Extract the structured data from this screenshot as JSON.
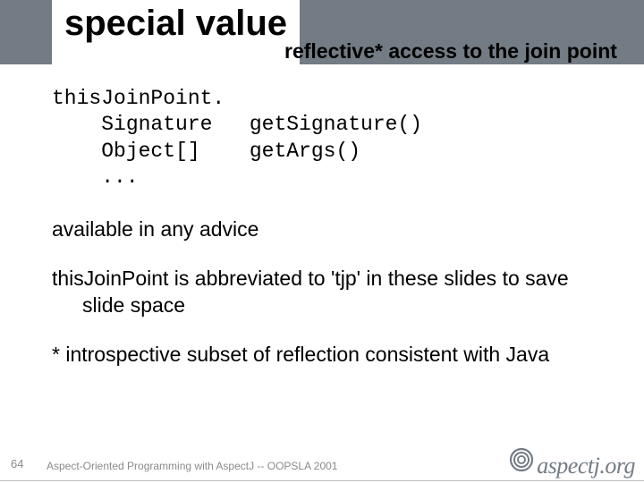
{
  "header": {
    "title": "special value",
    "subtitle": "reflective* access to the join point"
  },
  "code": {
    "line1": "thisJoinPoint.",
    "line2": "    Signature   getSignature()",
    "line3": "    Object[]    getArgs()",
    "line4": "    ..."
  },
  "paragraphs": {
    "p1": "available in any advice",
    "p2": "thisJoinPoint is abbreviated to 'tjp' in these slides to save slide space",
    "p3": "* introspective subset of reflection consistent with Java"
  },
  "footer": {
    "slide_number": "64",
    "text": "Aspect-Oriented Programming with AspectJ -- OOPSLA 2001",
    "logo_text": "aspectj.org"
  }
}
